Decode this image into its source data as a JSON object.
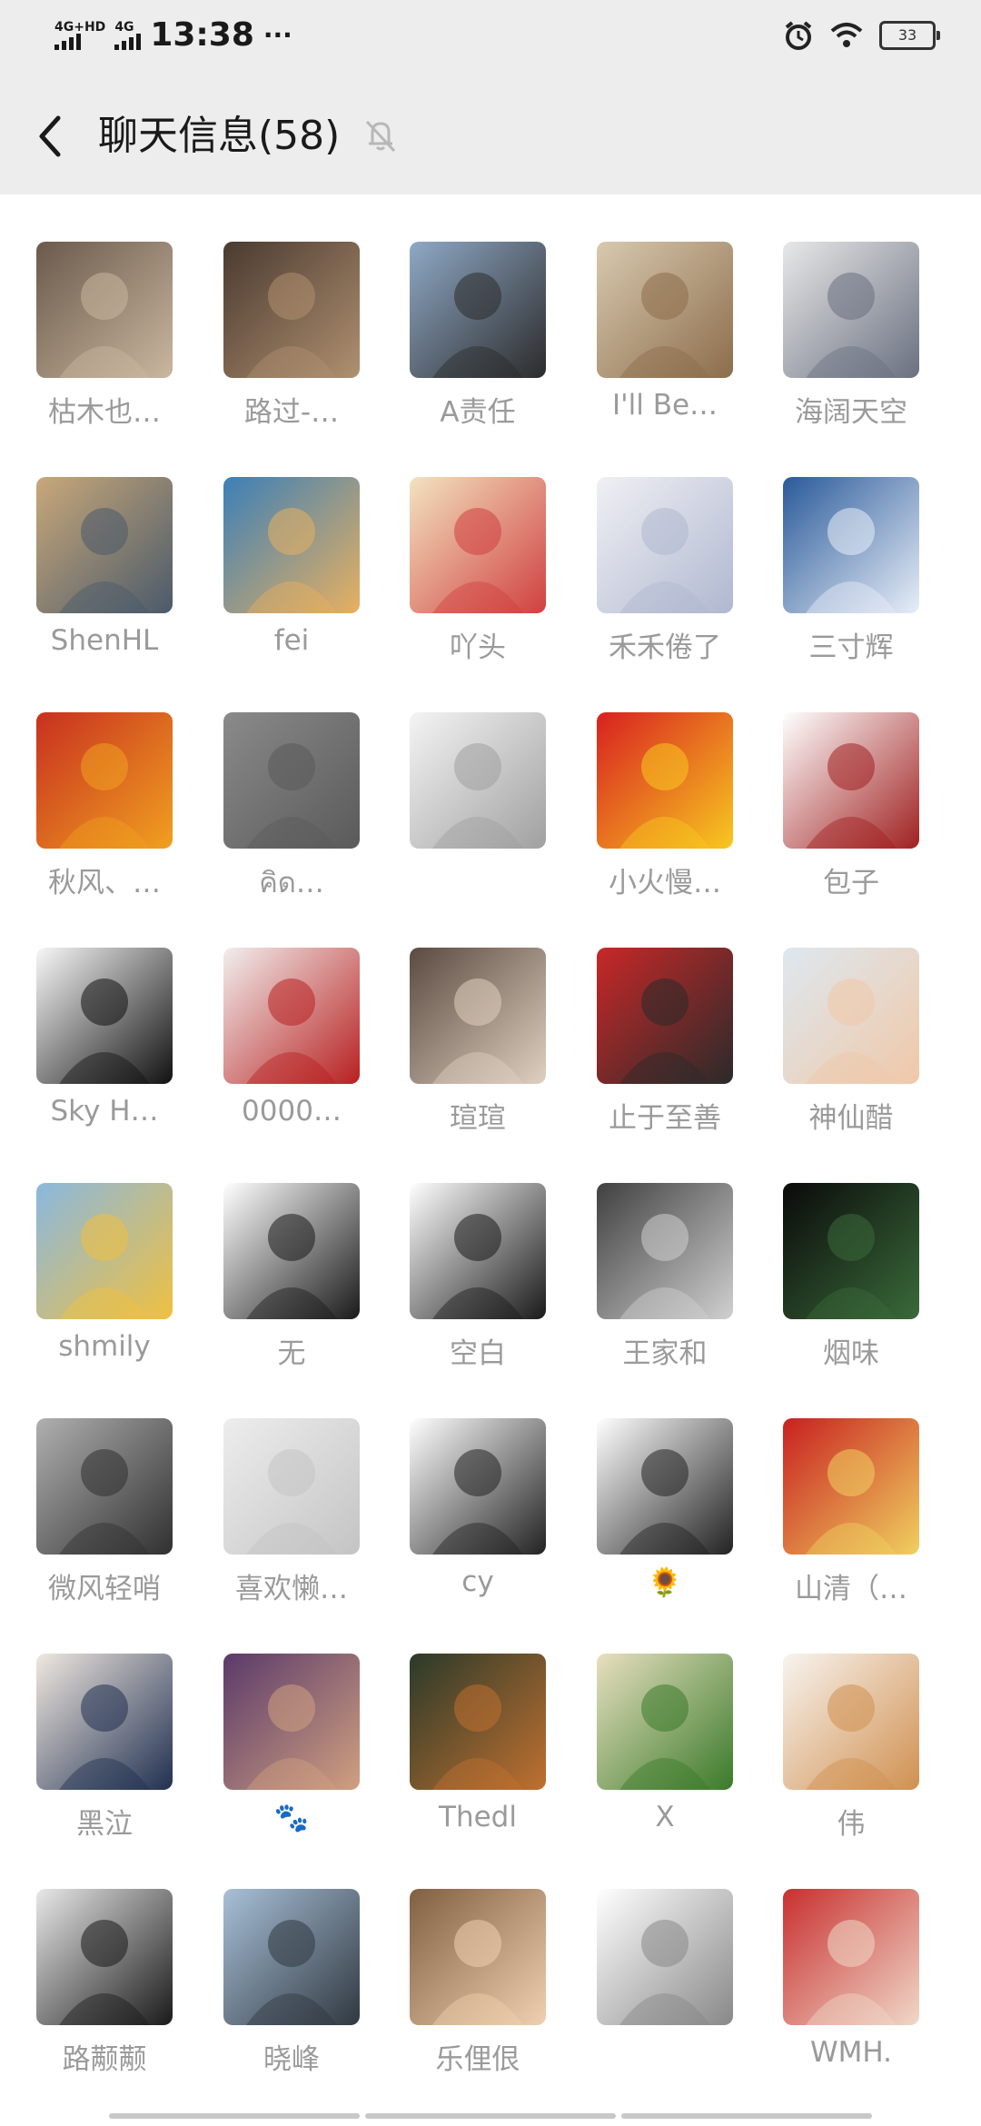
{
  "status_bar": {
    "network_1": "4G+HD",
    "network_2": "4G",
    "time": "13:38",
    "more": "···",
    "battery": "33",
    "icons": [
      "alarm-icon",
      "wifi-icon",
      "battery-icon"
    ]
  },
  "header": {
    "title": "聊天信息(58)",
    "icons": [
      "back-icon",
      "mute-bell-icon"
    ]
  },
  "members": [
    {
      "name": "枯木也…",
      "colors": [
        "#6b5a4c",
        "#c9b79f"
      ]
    },
    {
      "name": "路过-…",
      "colors": [
        "#4a3a30",
        "#b09070"
      ]
    },
    {
      "name": "A责任",
      "colors": [
        "#8fa9c6",
        "#2b2b2b"
      ]
    },
    {
      "name": "I'll Be…",
      "colors": [
        "#d8c9b0",
        "#8c6d4b"
      ]
    },
    {
      "name": "海阔天空",
      "colors": [
        "#e8e8e8",
        "#6a7080"
      ]
    },
    {
      "name": "ShenHL",
      "colors": [
        "#c9a87a",
        "#4a5a6a"
      ]
    },
    {
      "name": "fei",
      "colors": [
        "#3b7fb8",
        "#e8b060"
      ]
    },
    {
      "name": "吖头",
      "colors": [
        "#f3e3c0",
        "#d04040"
      ]
    },
    {
      "name": "禾禾倦了",
      "colors": [
        "#f0f0f4",
        "#b0b8d0"
      ]
    },
    {
      "name": "三寸辉",
      "colors": [
        "#2a5a9a",
        "#e8eef8"
      ]
    },
    {
      "name": "秋风、…",
      "colors": [
        "#c83020",
        "#f0a020"
      ]
    },
    {
      "name": "คิด…",
      "colors": [
        "#8a8a8a",
        "#5a5a5a"
      ]
    },
    {
      "name": "",
      "colors": [
        "#f4f4f4",
        "#a0a0a0"
      ]
    },
    {
      "name": "小火慢…",
      "colors": [
        "#d82020",
        "#f8c820"
      ]
    },
    {
      "name": "包子",
      "colors": [
        "#ffffff",
        "#a02020"
      ]
    },
    {
      "name": "Sky H…",
      "colors": [
        "#f8f8f8",
        "#111111"
      ]
    },
    {
      "name": "0000…",
      "colors": [
        "#f2eeee",
        "#b82020"
      ]
    },
    {
      "name": "瑄瑄",
      "colors": [
        "#5a4a40",
        "#e0d0c0"
      ]
    },
    {
      "name": "止于至善",
      "colors": [
        "#c82828",
        "#2a2a2a"
      ]
    },
    {
      "name": "神仙醋",
      "colors": [
        "#dde8f0",
        "#f0c8a8"
      ]
    },
    {
      "name": "shmily",
      "colors": [
        "#8ab8e0",
        "#f0c040"
      ]
    },
    {
      "name": "无",
      "colors": [
        "#ffffff",
        "#1a1a1a"
      ]
    },
    {
      "name": "空白",
      "colors": [
        "#ffffff",
        "#1a1a1a"
      ]
    },
    {
      "name": "王家和",
      "colors": [
        "#404040",
        "#d0d0d0"
      ]
    },
    {
      "name": "烟味",
      "colors": [
        "#0a0a0a",
        "#3a6a3a"
      ]
    },
    {
      "name": "微风轻哨",
      "colors": [
        "#b0b0b0",
        "#303030"
      ]
    },
    {
      "name": "喜欢懒…",
      "colors": [
        "#ededed",
        "#c4c4c4"
      ]
    },
    {
      "name": "cy",
      "colors": [
        "#ffffff",
        "#222222"
      ]
    },
    {
      "name": "🌻",
      "colors": [
        "#ffffff",
        "#222222"
      ]
    },
    {
      "name": "山清（…",
      "colors": [
        "#c82020",
        "#f0d060"
      ]
    },
    {
      "name": "黑泣",
      "colors": [
        "#f0e8e0",
        "#203050"
      ]
    },
    {
      "name": "🐾",
      "colors": [
        "#5a3a6a",
        "#d0a080"
      ]
    },
    {
      "name": "Thedl",
      "colors": [
        "#2a3a2a",
        "#c07030"
      ]
    },
    {
      "name": "X",
      "colors": [
        "#e8e0c0",
        "#3a7a2a"
      ]
    },
    {
      "name": "伟",
      "colors": [
        "#f8f4f0",
        "#d09050"
      ]
    },
    {
      "name": "路颟颟",
      "colors": [
        "#e8e8e8",
        "#1a1a1a"
      ]
    },
    {
      "name": "晓峰",
      "colors": [
        "#a8c0d8",
        "#303840"
      ]
    },
    {
      "name": "乐俚佷",
      "colors": [
        "#806040",
        "#f0d0b0"
      ]
    },
    {
      "name": "",
      "colors": [
        "#ffffff",
        "#888888"
      ]
    },
    {
      "name": "WMH.",
      "colors": [
        "#c83030",
        "#f0d8c8"
      ]
    }
  ]
}
